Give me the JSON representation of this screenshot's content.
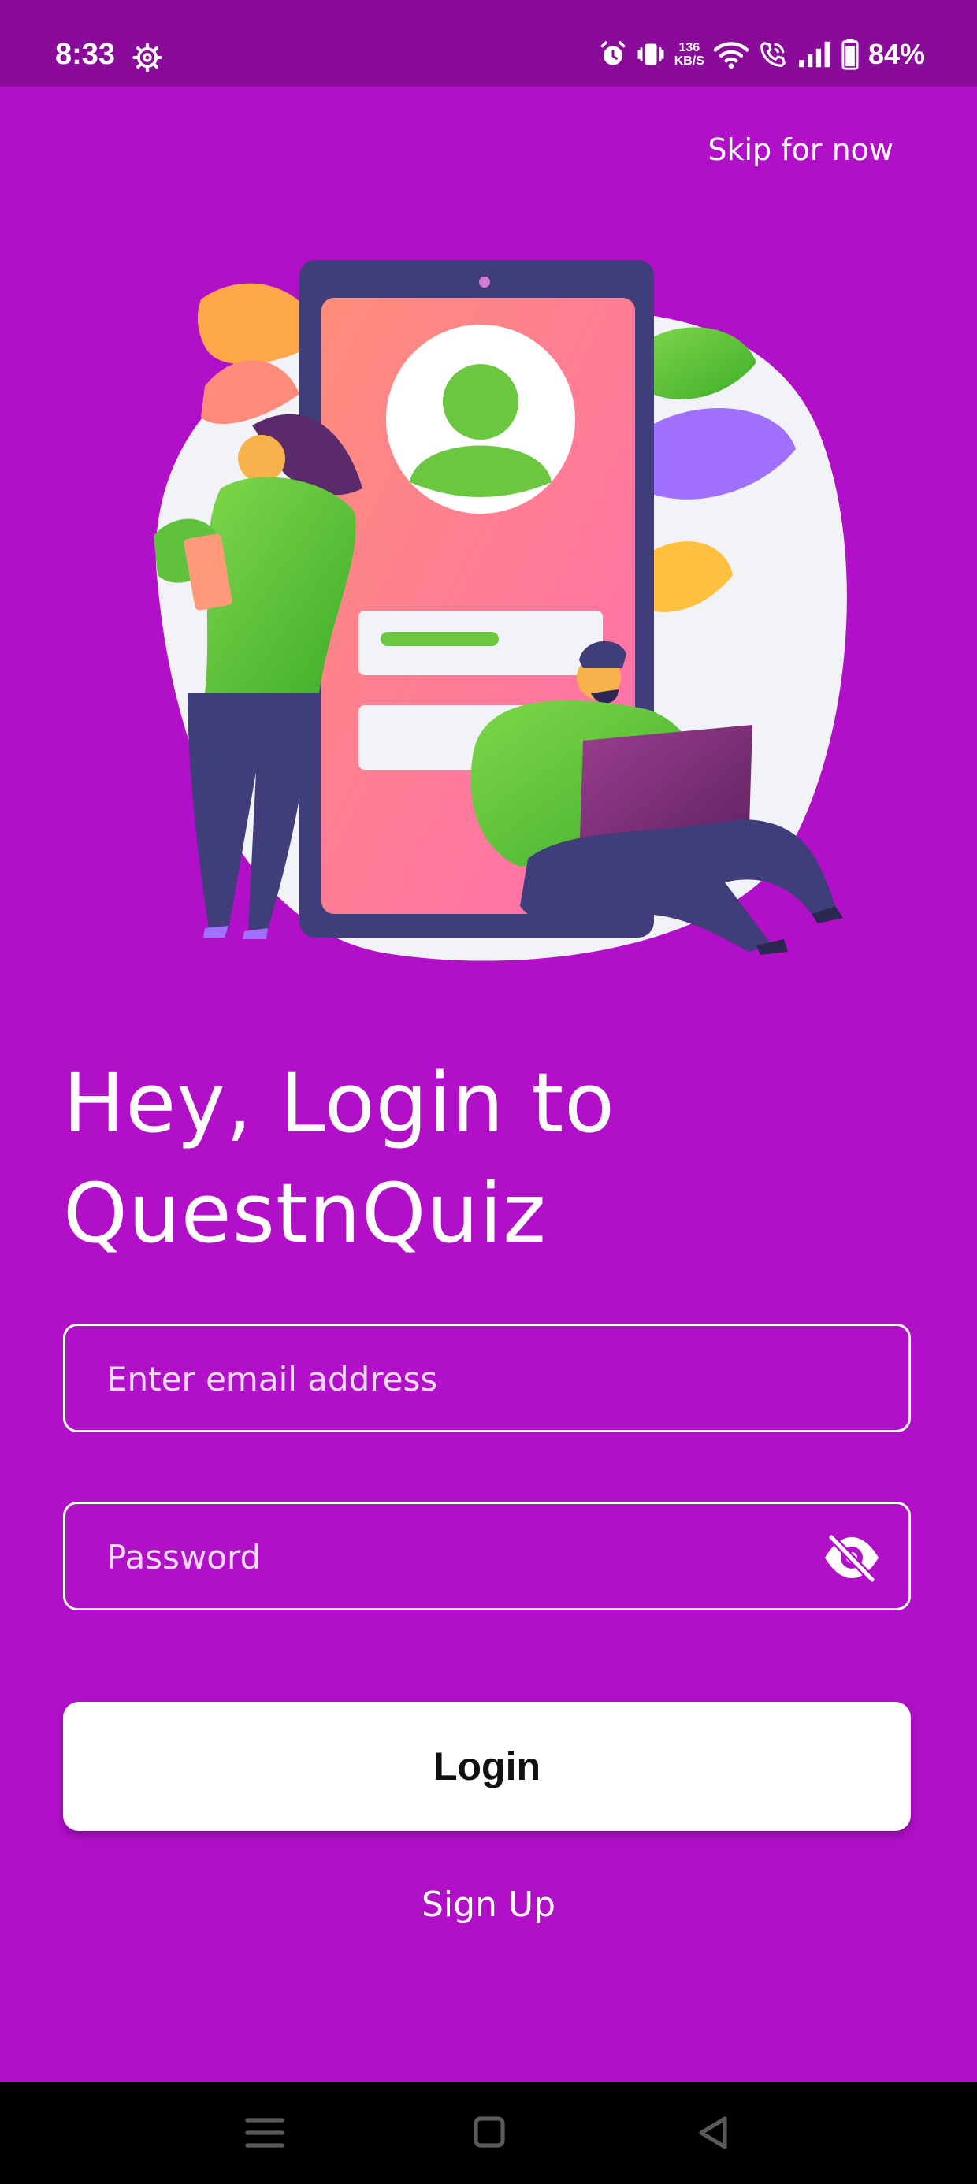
{
  "status_bar": {
    "time": "8:33",
    "net_speed_value": "136",
    "net_speed_unit": "KB/S",
    "battery": "84%"
  },
  "header": {
    "skip_label": "Skip for now"
  },
  "title": {
    "line1": "Hey, Login to",
    "line2": "QuestnQuiz"
  },
  "form": {
    "email_placeholder": "Enter email address",
    "password_placeholder": "Password",
    "login_label": "Login",
    "signup_label": "Sign Up"
  },
  "icons": {
    "settings": "gear-icon",
    "alarm": "alarm-icon",
    "vibrate": "vibrate-icon",
    "wifi": "wifi-icon",
    "call": "wifi-call-icon",
    "signal": "signal-icon",
    "battery": "battery-icon",
    "password_toggle": "eye-off-icon",
    "nav_menu": "menu-icon",
    "nav_home": "home-icon",
    "nav_back": "back-icon"
  },
  "colors": {
    "background": "#b20fc9",
    "status_bar": "#8a0a99",
    "button_bg": "#ffffff",
    "button_text": "#111111"
  }
}
